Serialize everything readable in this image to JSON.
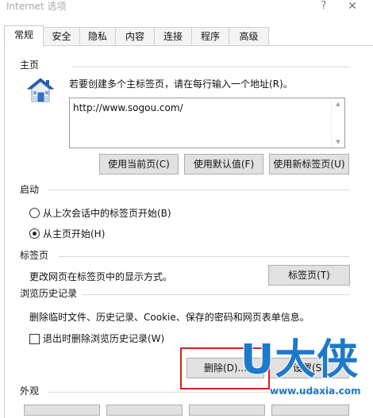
{
  "window": {
    "title": "Internet 选项",
    "help": "?",
    "close": "✕"
  },
  "tabs": [
    {
      "label": "常规",
      "active": true
    },
    {
      "label": "安全"
    },
    {
      "label": "隐私"
    },
    {
      "label": "内容"
    },
    {
      "label": "连接"
    },
    {
      "label": "程序"
    },
    {
      "label": "高级"
    }
  ],
  "home": {
    "heading": "主页",
    "description": "若要创建多个主标签页，请在每行输入一个地址(R)。",
    "url": "http://www.sogou.com/",
    "icon": "home-icon",
    "buttons": {
      "use_current": "使用当前页(C)",
      "use_default": "使用默认值(F)",
      "use_new_tab": "使用新标签页(U)"
    }
  },
  "startup": {
    "heading": "启动",
    "option_last_session": "从上次会话中的标签页开始(B)",
    "option_home": "从主页开始(H)",
    "selected": "option_home"
  },
  "tabs_group": {
    "heading": "标签页",
    "description": "更改网页在标签页中的显示方式。",
    "button": "标签页(T)"
  },
  "history": {
    "heading": "浏览历史记录",
    "description": "删除临时文件、历史记录、Cookie、保存的密码和网页表单信息。",
    "checkbox_label": "退出时删除浏览历史记录(W)",
    "checkbox_checked": false,
    "delete_button": "删除(D)...",
    "settings_button": "设置(S)"
  },
  "appearance": {
    "heading": "外观"
  },
  "watermark": {
    "brand": "U大侠",
    "url": "www.udaxia.com"
  },
  "colors": {
    "highlight": "#d42020",
    "watermark": "#1f79c9"
  }
}
